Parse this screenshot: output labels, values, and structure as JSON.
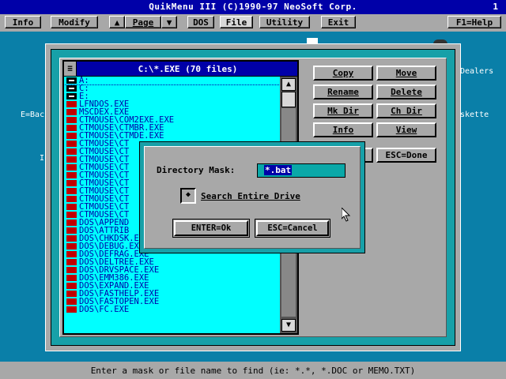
{
  "titlebar": {
    "title": "QuikMenu III (C)1990-97 NeoSoft Corp.",
    "window_number": "1"
  },
  "menubar": {
    "info": "Info",
    "modify": "Modify",
    "page_up_arrow": "▲",
    "page": "Page",
    "page_down_arrow": "▼",
    "dos": "DOS",
    "file": "File",
    "utility": "Utility",
    "exit": "Exit",
    "help": "F1=Help"
  },
  "background": {
    "dealers": "Dealers",
    "e_back": "E=Bac",
    "skette": "skette",
    "i": "I"
  },
  "filelist": {
    "close_glyph": "≡",
    "header": "C:\\*.EXE (70 files)",
    "items": [
      {
        "name": "A:",
        "kind": "drive"
      },
      {
        "name": "C:",
        "kind": "drive"
      },
      {
        "name": "E:",
        "kind": "drive"
      },
      {
        "name": "LFNDOS.EXE",
        "kind": "file"
      },
      {
        "name": "MSCDEX.EXE",
        "kind": "file"
      },
      {
        "name": "CTMOUSE\\COM2EXE.EXE",
        "kind": "file"
      },
      {
        "name": "CTMOUSE\\CTMBR.EXE",
        "kind": "file"
      },
      {
        "name": "CTMOUSE\\CTMDE.EXE",
        "kind": "file"
      },
      {
        "name": "CTMOUSE\\CT",
        "kind": "file"
      },
      {
        "name": "CTMOUSE\\CT",
        "kind": "file"
      },
      {
        "name": "CTMOUSE\\CT",
        "kind": "file"
      },
      {
        "name": "CTMOUSE\\CT",
        "kind": "file"
      },
      {
        "name": "CTMOUSE\\CT",
        "kind": "file"
      },
      {
        "name": "CTMOUSE\\CT",
        "kind": "file"
      },
      {
        "name": "CTMOUSE\\CT",
        "kind": "file"
      },
      {
        "name": "CTMOUSE\\CT",
        "kind": "file"
      },
      {
        "name": "CTMOUSE\\CT",
        "kind": "file"
      },
      {
        "name": "CTMOUSE\\CT",
        "kind": "file"
      },
      {
        "name": "DOS\\APPEND",
        "kind": "file"
      },
      {
        "name": "DOS\\ATTRIB",
        "kind": "file"
      },
      {
        "name": "DOS\\CHKDSK.EXE",
        "kind": "file"
      },
      {
        "name": "DOS\\DEBUG.EXE",
        "kind": "file"
      },
      {
        "name": "DOS\\DEFRAG.EXE",
        "kind": "file"
      },
      {
        "name": "DOS\\DELTREE.EXE",
        "kind": "file"
      },
      {
        "name": "DOS\\DRVSPACE.EXE",
        "kind": "file"
      },
      {
        "name": "DOS\\EMM386.EXE",
        "kind": "file"
      },
      {
        "name": "DOS\\EXPAND.EXE",
        "kind": "file"
      },
      {
        "name": "DOS\\FASTHELP.EXE",
        "kind": "file"
      },
      {
        "name": "DOS\\FASTOPEN.EXE",
        "kind": "file"
      },
      {
        "name": "DOS\\FC.EXE",
        "kind": "file"
      }
    ]
  },
  "scrollbar": {
    "up": "▲",
    "down": "▼"
  },
  "actions": {
    "copy": "Copy",
    "move": "Move",
    "rename": "Rename",
    "delete": "Delete",
    "mkdir": "Mk Dir",
    "chdir": "Ch Dir",
    "info": "Info",
    "view": "View",
    "done": "ESC=Done"
  },
  "mask_dialog": {
    "label": "Directory Mask:",
    "value": "*.bat",
    "checkbox_glyph": "◆",
    "checkbox_label": "Search Entire Drive",
    "checkbox_checked": true,
    "ok": "ENTER=Ok",
    "cancel": "ESC=Cancel"
  },
  "statusbar": {
    "text": "Enter a mask or file name to find (ie: *.*, *.DOC or MEMO.TXT)"
  },
  "colors": {
    "desktop": "#0a7fa8",
    "titlebar": "#0000a8",
    "list_bg": "#00ffff",
    "list_text": "#0000a8",
    "panel": "#a8a8a8",
    "file_icon": "#c00000"
  }
}
